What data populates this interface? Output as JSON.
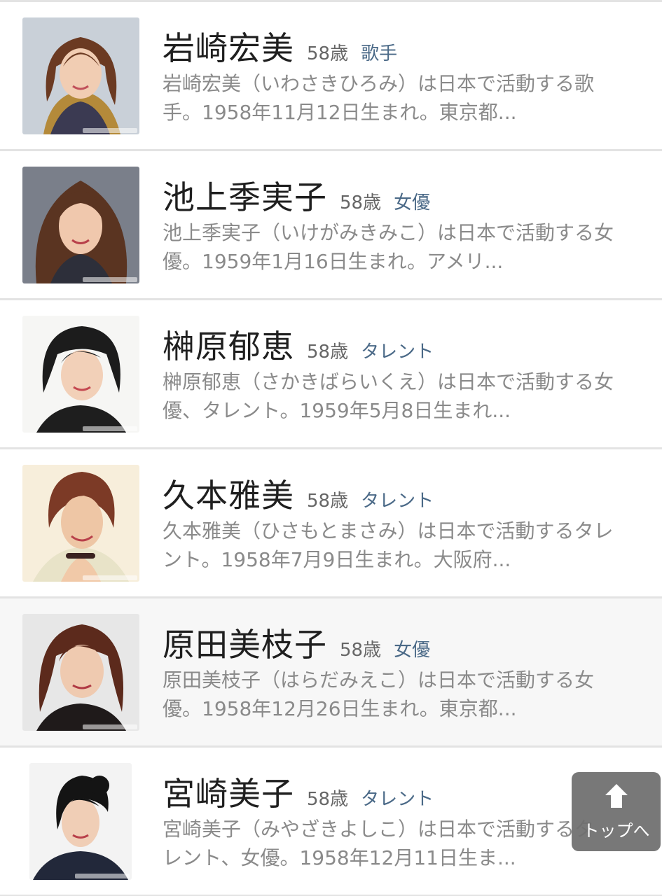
{
  "people": [
    {
      "name": "岩崎宏美",
      "age": "58歳",
      "category": "歌手",
      "desc_line1": "岩崎宏美（いわさきひろみ）は日本で活動する歌",
      "desc_line2": "手。1958年11月12日生まれ。東京都..."
    },
    {
      "name": "池上季実子",
      "age": "58歳",
      "category": "女優",
      "desc_line1": "池上季実子（いけがみきみこ）は日本で活動する女",
      "desc_line2": "優。1959年1月16日生まれ。アメリ..."
    },
    {
      "name": "榊原郁恵",
      "age": "58歳",
      "category": "タレント",
      "desc_line1": "榊原郁恵（さかきばらいくえ）は日本で活動する女",
      "desc_line2": "優、タレント。1959年5月8日生まれ..."
    },
    {
      "name": "久本雅美",
      "age": "58歳",
      "category": "タレント",
      "desc_line1": "久本雅美（ひさもとまさみ）は日本で活動するタレ",
      "desc_line2": "ント。1958年7月9日生まれ。大阪府..."
    },
    {
      "name": "原田美枝子",
      "age": "58歳",
      "category": "女優",
      "desc_line1": "原田美枝子（はらだみえこ）は日本で活動する女",
      "desc_line2": "優。1958年12月26日生まれ。東京都..."
    },
    {
      "name": "宮崎美子",
      "age": "58歳",
      "category": "タレント",
      "desc_line1": "宮崎美子（みやざきよしこ）は日本で活動するタ",
      "desc_line2": "レント、女優。1958年12月11日生ま..."
    }
  ],
  "top_button": {
    "label": "トップへ",
    "icon": "arrow-up-icon"
  },
  "colors": {
    "name": "#1f1f1f",
    "age": "#666666",
    "category": "#4a6987",
    "description": "#8a8a8a",
    "divider": "#e3e3e3"
  }
}
